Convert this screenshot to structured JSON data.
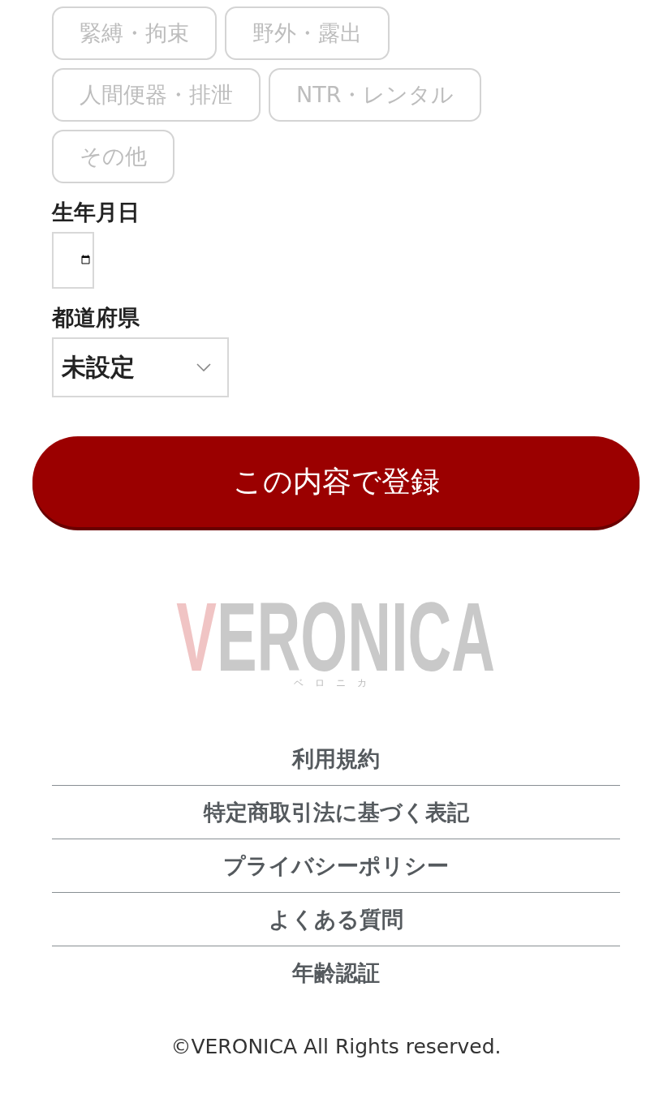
{
  "tags": [
    {
      "label": "緊縛・拘束",
      "selected": false
    },
    {
      "label": "野外・露出",
      "selected": false
    },
    {
      "label": "人間便器・排泄",
      "selected": false
    },
    {
      "label": "NTR・レンタル",
      "selected": false
    },
    {
      "label": "その他",
      "selected": false
    }
  ],
  "birthday": {
    "label": "生年月日"
  },
  "prefecture": {
    "label": "都道府県",
    "value": "未設定"
  },
  "submit": "この内容で登録",
  "logo": {
    "initial": "V",
    "name": "ERONICA",
    "kana": "ベロニカ"
  },
  "footer_links": [
    "利用規約",
    "特定商取引法に基づく表記",
    "プライバシーポリシー",
    "よくある質問",
    "年齢認証"
  ],
  "copyright": "©VERONICA All Rights reserved."
}
